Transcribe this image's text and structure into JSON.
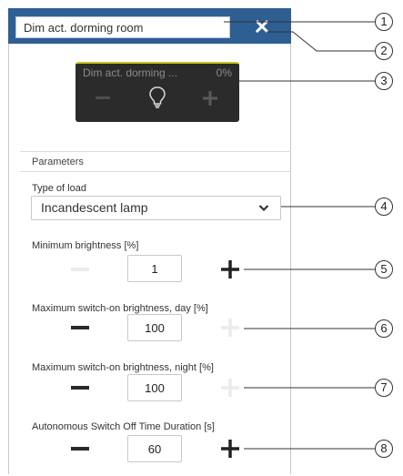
{
  "header": {
    "title_value": "Dim act. dorming room",
    "close_icon": "close-icon",
    "color": "#2e5f93"
  },
  "tile": {
    "name": "Dim act. dorming ...",
    "value": "0%",
    "icon": "bulb-icon",
    "accent_color": "#c9c21e"
  },
  "parameters": {
    "section_title": "Parameters",
    "type_of_load": {
      "label": "Type of load",
      "selected": "Incandescent lamp"
    },
    "minimum_brightness": {
      "label": "Minimum brightness [%]",
      "value": "1",
      "minus_enabled": false,
      "plus_enabled": true
    },
    "max_brightness_day": {
      "label": "Maximum switch-on brightness, day [%]",
      "value": "100",
      "minus_enabled": true,
      "plus_enabled": false
    },
    "max_brightness_night": {
      "label": "Maximum switch-on brightness, night [%]",
      "value": "100",
      "minus_enabled": true,
      "plus_enabled": false
    },
    "switch_off_duration": {
      "label": "Autonomous Switch Off Time Duration [s]",
      "value": "60",
      "minus_enabled": true,
      "plus_enabled": true
    }
  },
  "callouts": [
    "1",
    "2",
    "3",
    "4",
    "5",
    "6",
    "7",
    "8"
  ]
}
